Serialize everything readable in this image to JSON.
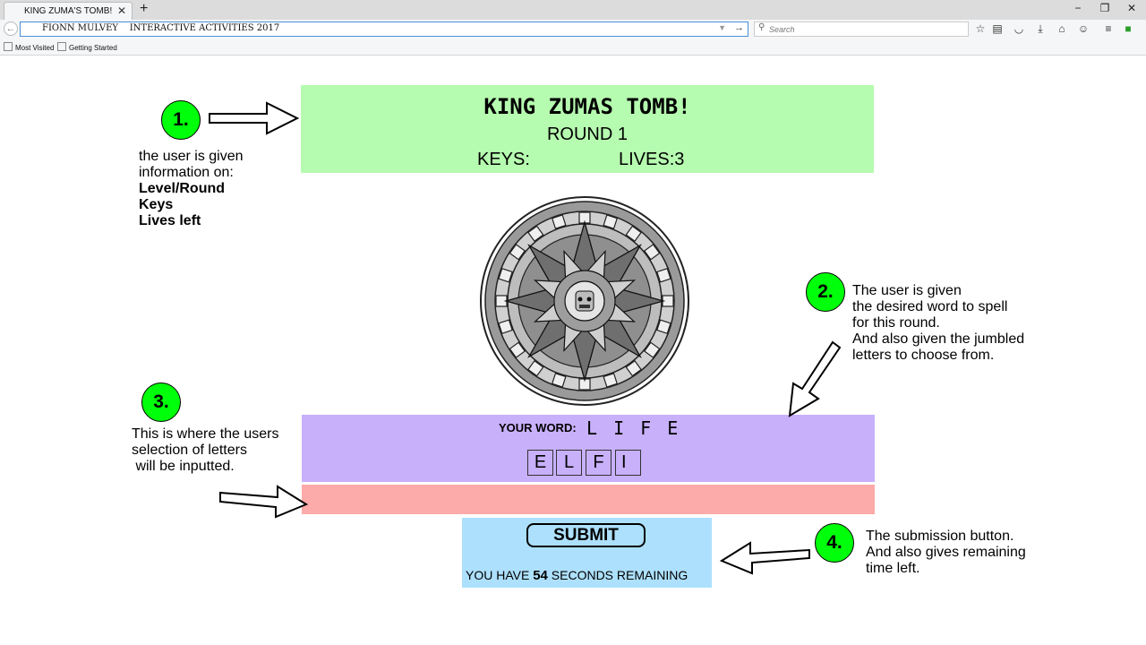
{
  "browser": {
    "tab_title": "KING ZUMA'S TOMB!",
    "url": "FIONN MULVEY    INTERACTIVE ACTIVITIES 2017",
    "search_placeholder": "Search",
    "bookmarks": [
      "Most Visited",
      "Getting Started"
    ]
  },
  "header": {
    "title": "KING  ZUMAS  TOMB!",
    "round": "ROUND 1",
    "keys": "KEYS:",
    "lives": "LIVES:3"
  },
  "word": {
    "label": "YOUR WORD:",
    "target": "L I F E",
    "tiles": [
      "E",
      "L",
      "F",
      "I"
    ]
  },
  "submit": {
    "button_label": "SUBMIT",
    "timer_prefix": "YOU HAVE ",
    "seconds": "54",
    "timer_suffix": " SECONDS REMAINING"
  },
  "annotations": [
    {
      "number": "1.",
      "text": "the user is given\ninformation on:",
      "bold": "Level/Round\nKeys\nLives left"
    },
    {
      "number": "2.",
      "text": "The user is given\nthe desired word to spell\nfor this round.\nAnd also given the jumbled\nletters to choose from."
    },
    {
      "number": "3.",
      "text": "This is where the users\nselection of letters\n will be inputted."
    },
    {
      "number": "4.",
      "text": "The submission button.\nAnd also gives remaining\ntime left."
    }
  ]
}
